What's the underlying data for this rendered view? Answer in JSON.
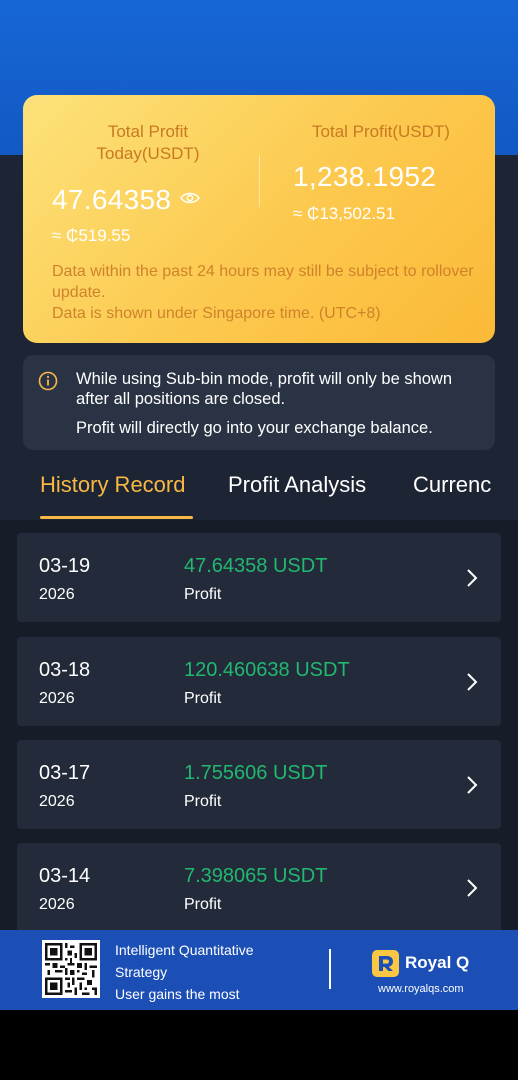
{
  "profit_card": {
    "today_label": "Total Profit Today(USDT)",
    "today_value": "47.64358",
    "today_fiat": "≈ ₵519.55",
    "total_label": "Total Profit(USDT)",
    "total_value": "1,238.1952",
    "total_fiat": "≈ ₵13,502.51",
    "note_line1": "Data within the past 24 hours may still be subject to rollover update.",
    "note_line2": "Data is shown under Singapore time. (UTC+8)",
    "eye_icon": "eye-icon"
  },
  "notice": {
    "icon": "info-icon",
    "line1": "While using Sub-bin mode, profit will only be shown after all positions are closed.",
    "line2": "Profit will directly go into your exchange balance."
  },
  "tabs": [
    {
      "label": "History Record",
      "active": true
    },
    {
      "label": "Profit Analysis",
      "active": false
    },
    {
      "label": "Currenc",
      "active": false
    }
  ],
  "records": [
    {
      "date": "03-19",
      "year": "2026",
      "amount": "47.64358 USDT",
      "label": "Profit"
    },
    {
      "date": "03-18",
      "year": "2026",
      "amount": "120.460638 USDT",
      "label": "Profit"
    },
    {
      "date": "03-17",
      "year": "2026",
      "amount": "1.755606 USDT",
      "label": "Profit"
    },
    {
      "date": "03-14",
      "year": "2026",
      "amount": "7.398065 USDT",
      "label": "Profit"
    }
  ],
  "footer": {
    "line1": "Intelligent Quantitative",
    "line2": "Strategy",
    "line3": "User gains the most",
    "brand_name": "Royal Q",
    "brand_url": "www.royalqs.com"
  },
  "colors": {
    "accent": "#f7b845",
    "profit_green": "#21b870",
    "card_gold": "#fcc94e",
    "brand_blue": "#1b4fb5"
  }
}
